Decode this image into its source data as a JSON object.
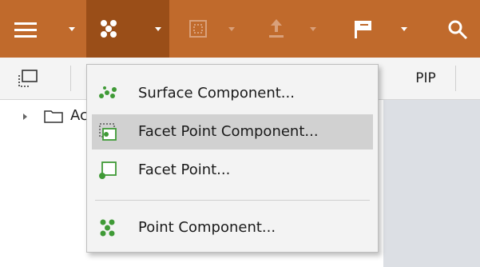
{
  "toolbar": {
    "buttons": [
      {
        "icon": "hamburger-menu-icon",
        "has_dropdown": true
      },
      {
        "icon": "point-component-icon",
        "has_dropdown": true,
        "active": true
      },
      {
        "icon": "frame-select-icon",
        "has_dropdown": true,
        "disabled": true
      },
      {
        "icon": "upload-icon",
        "has_dropdown": true,
        "disabled": true
      },
      {
        "icon": "flag-icon",
        "has_dropdown": true
      },
      {
        "icon": "search-icon",
        "has_dropdown": false
      }
    ],
    "colors": {
      "background": "#c06a2c",
      "active": "#9a4e18"
    }
  },
  "secondary_bar": {
    "pip_label": "PIP"
  },
  "tree": {
    "first_item_label": "Ac"
  },
  "dropdown_menu": {
    "items": [
      {
        "label": "Surface Component...",
        "icon": "surface-component-icon"
      },
      {
        "label": "Facet Point Component...",
        "icon": "facet-point-component-icon",
        "highlighted": true
      },
      {
        "label": "Facet Point...",
        "icon": "facet-point-icon"
      },
      {
        "label": "Point Component...",
        "icon": "point-component-icon"
      }
    ],
    "colors": {
      "background": "#f3f3f3",
      "highlight": "#d1d1d1",
      "icon_green": "#3f9a36"
    }
  }
}
